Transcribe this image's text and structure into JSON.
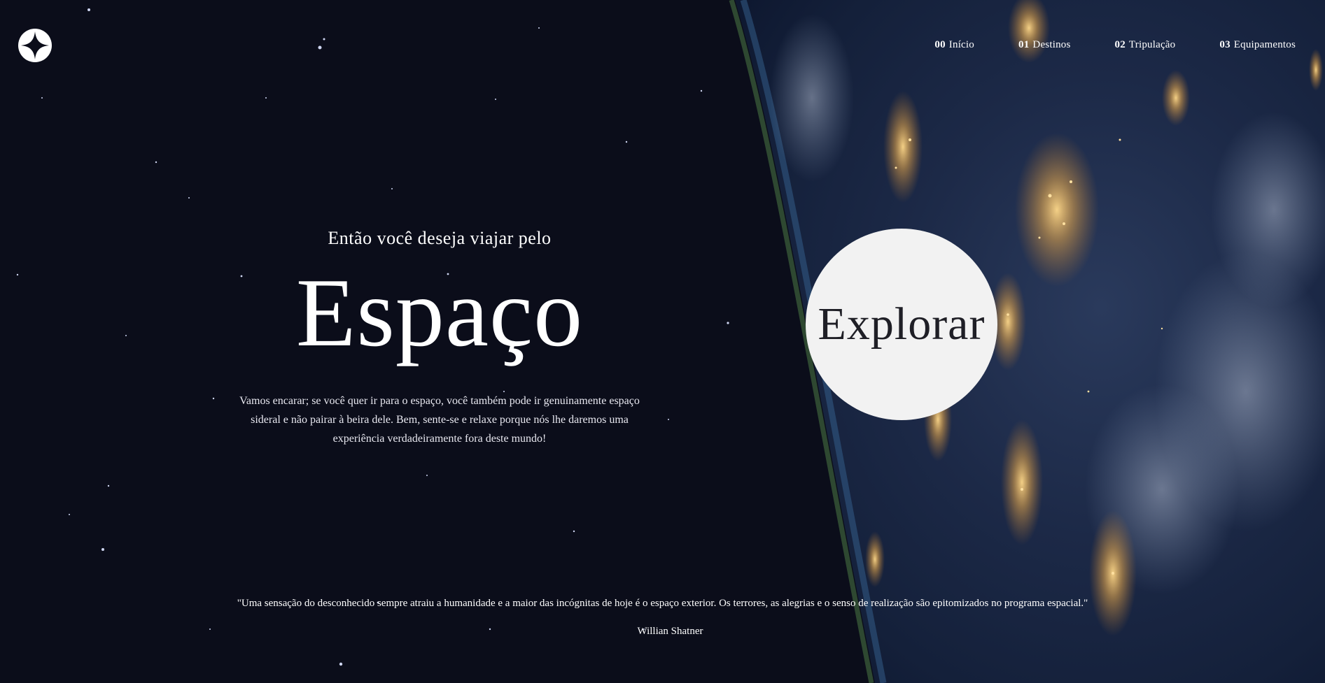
{
  "nav": {
    "items": [
      {
        "num": "00",
        "label": "Início"
      },
      {
        "num": "01",
        "label": "Destinos"
      },
      {
        "num": "02",
        "label": "Tripulação"
      },
      {
        "num": "03",
        "label": "Equipamentos"
      }
    ]
  },
  "hero": {
    "eyebrow": "Então você deseja viajar pelo",
    "title": "Espaço",
    "description": "Vamos encarar; se você quer ir para o espaço, você também pode ir genuinamente espaço sideral e não pairar à beira dele. Bem, sente-se e relaxe porque nós lhe daremos uma experiência verdadeiramente fora deste mundo!"
  },
  "cta": {
    "label": "Explorar"
  },
  "quote": {
    "text": "\"Uma sensação do desconhecido sempre atraiu a humanidade e a maior das incógnitas de hoje é o espaço exterior. Os terrores, as alegrias e o senso de realização são epitomizados no programa espacial.\"",
    "author": "Willian Shatner"
  },
  "icons": {
    "logo": "four-point-star-icon"
  },
  "colors": {
    "space_background": "#0b0d1a",
    "button_background": "#f2f2f2",
    "button_text": "#1f1f26",
    "text": "#ffffff"
  }
}
